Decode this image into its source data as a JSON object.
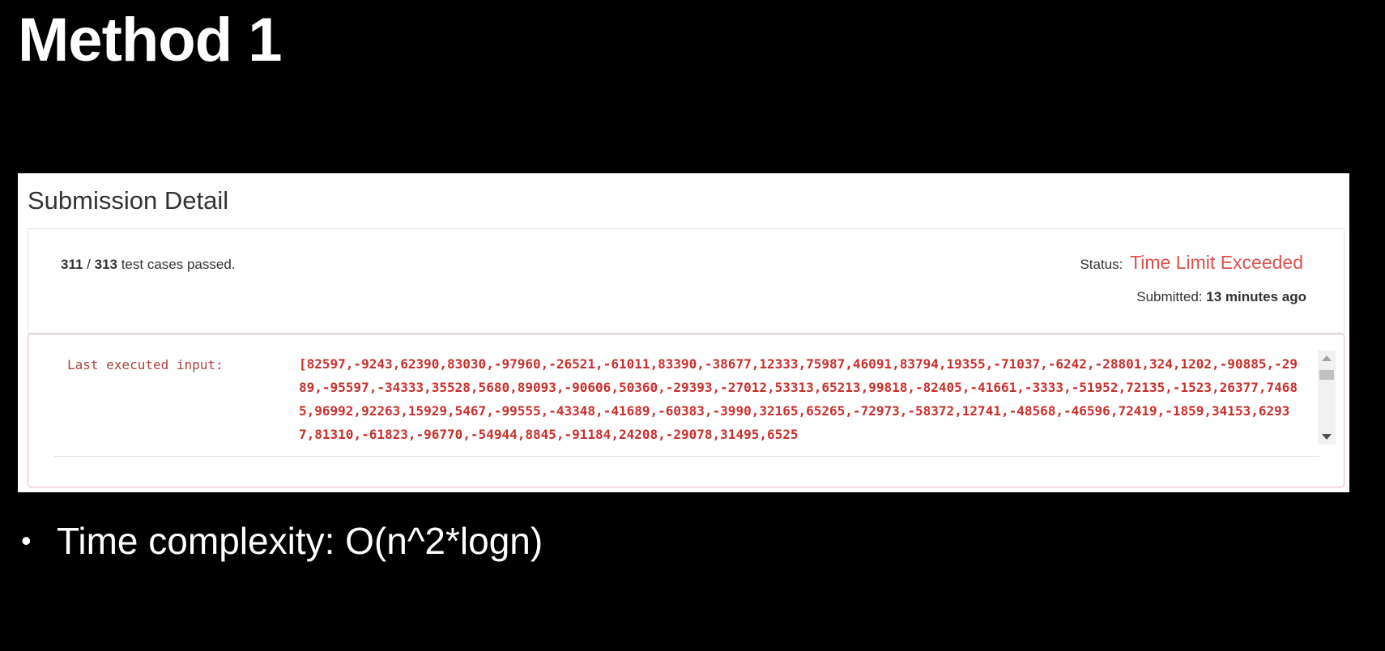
{
  "slide": {
    "title": "Method 1",
    "bullet_symbol": "•",
    "bullet_text": "Time complexity: O(n^2*logn)"
  },
  "submission": {
    "heading": "Submission Detail",
    "passed_count": "311",
    "separator": " / ",
    "total_count": "313",
    "passed_suffix": " test cases passed.",
    "status_label": "Status:",
    "status_value": "Time Limit Exceeded",
    "submitted_label": "Submitted:",
    "submitted_value": "13 minutes ago",
    "last_input_label": "Last executed input:",
    "last_input_value": "[82597,-9243,62390,83030,-97960,-26521,-61011,83390,-38677,12333,75987,46091,83794,19355,-71037,-6242,-28801,324,1202,-90885,-2989,-95597,-34333,35528,5680,89093,-90606,50360,-29393,-27012,53313,65213,99818,-82405,-41661,-3333,-51952,72135,-1523,26377,74685,96992,92263,15929,5467,-99555,-43348,-41689,-60383,-3990,32165,65265,-72973,-58372,12741,-48568,-46596,72419,-1859,34153,62937,81310,-61823,-96770,-54944,8845,-91184,24208,-29078,31495,6525"
  },
  "colors": {
    "status_error": "#d9534f",
    "input_text": "#c9302c",
    "background": "#000000",
    "panel": "#ffffff"
  }
}
